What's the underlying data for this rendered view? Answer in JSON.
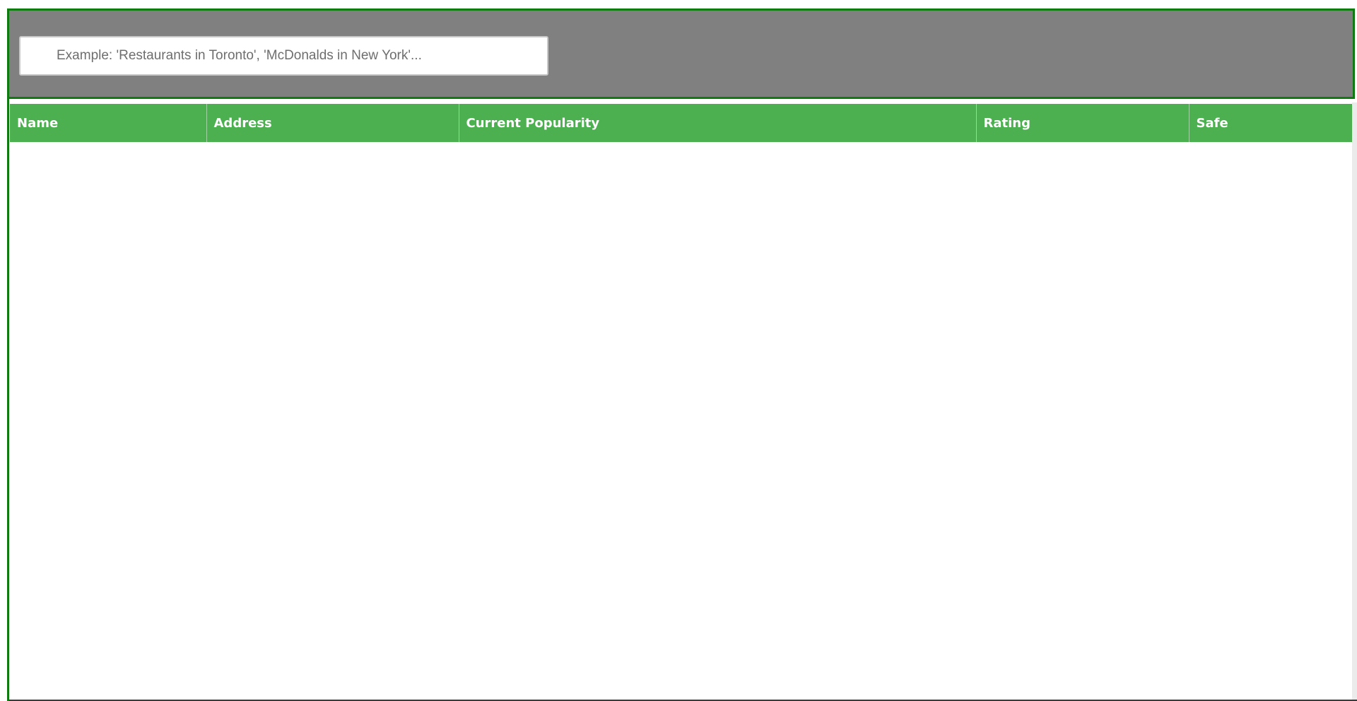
{
  "search": {
    "placeholder": "Example: 'Restaurants in Toronto', 'McDonalds in New York'...",
    "value": ""
  },
  "table": {
    "columns": [
      "Name",
      "Address",
      "Current Popularity",
      "Rating",
      "Safe"
    ],
    "rows": []
  },
  "colors": {
    "header_panel_bg": "#808080",
    "header_panel_border": "#0f7a0f",
    "table_header_bg": "#4caf50",
    "table_header_text": "#ffffff"
  }
}
